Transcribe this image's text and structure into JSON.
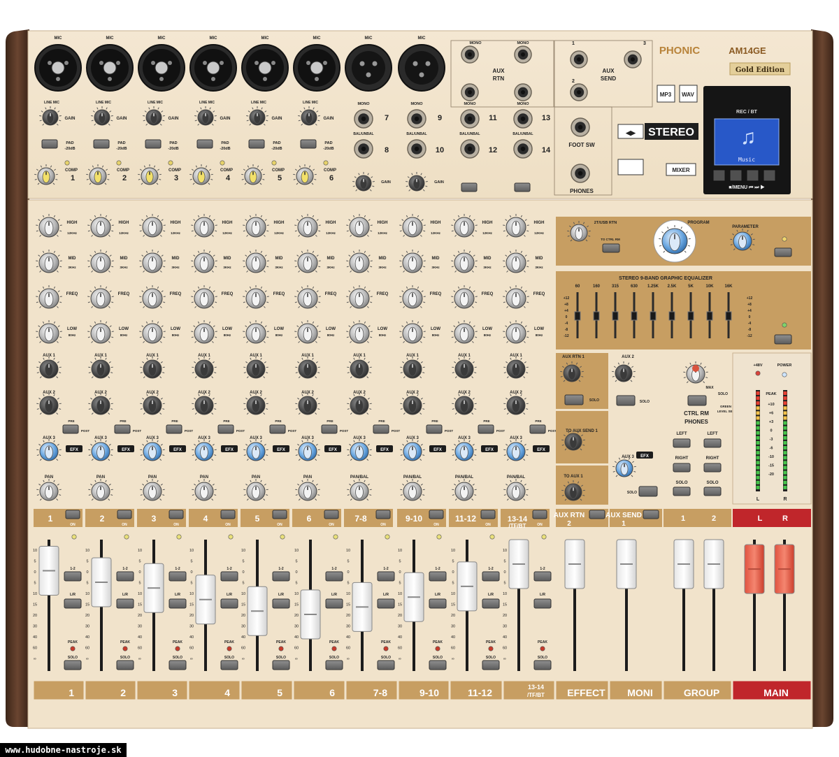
{
  "brand": {
    "name": "PHONIC",
    "model": "AM14GE",
    "edition": "Gold Edition"
  },
  "top_badges": {
    "mp3": "MP3",
    "wav": "WAV",
    "stereo": "STEREO",
    "mixer": "MIXER"
  },
  "display": {
    "header": "REC / BT",
    "screen_text": "Music",
    "controls": "■/MENU  ⏮  ⏭  ▶"
  },
  "inputs": {
    "mic_label": "MIC",
    "line_mic_label": "LINE MIC",
    "gain_label": "GAIN",
    "pad_label": "PAD -20dB",
    "comp_label": "COMP",
    "mic_channels": [
      "1",
      "2",
      "3",
      "4",
      "5",
      "6"
    ],
    "stereo_groups": [
      {
        "mono": "MONO",
        "bal": "BAL/UNBAL",
        "ch_top": "7",
        "ch_bot": "8"
      },
      {
        "mono": "MONO",
        "bal": "BAL/UNBAL",
        "ch_top": "9",
        "ch_bot": "10"
      },
      {
        "mono": "MONO",
        "bal": "BAL/UNBAL",
        "ch_top": "11",
        "ch_bot": "12"
      },
      {
        "mono": "MONO",
        "bal": "BAL/UNBAL",
        "ch_top": "13",
        "ch_bot": "14"
      }
    ]
  },
  "aux_rtn": {
    "label": "AUX RTN",
    "mono": "MONO"
  },
  "aux_send": {
    "label": "AUX SEND",
    "nums": [
      "1",
      "2",
      "3"
    ]
  },
  "foot_sw": "FOOT SW",
  "phones": "PHONES",
  "channel_strip": {
    "eq_labels": [
      "HIGH",
      "MID",
      "FREQ",
      "LOW"
    ],
    "eq_freqs": [
      "12KHz",
      "3KHz",
      "80Hz"
    ],
    "aux_labels": [
      "AUX 1",
      "AUX 2",
      "AUX 3"
    ],
    "efx": "EFX",
    "pan": "PAN",
    "pan_bal": "PAN/BAL",
    "pre": "PRE",
    "post": "POST",
    "on": "ON",
    "peak": "PEAK",
    "solo": "SOLO",
    "assign_12": "1-2",
    "assign_lr": "L/R"
  },
  "channel_labels": [
    "1",
    "2",
    "3",
    "4",
    "5",
    "6",
    "7-8",
    "9-10",
    "11-12",
    "13-14 /TF/BT"
  ],
  "bottom_labels": [
    "1",
    "2",
    "3",
    "4",
    "5",
    "6",
    "7-8",
    "9-10",
    "11-12",
    "13-14 /TF/BT",
    "EFFECT",
    "MONI",
    "GROUP",
    "MAIN"
  ],
  "master_top_labels": [
    "AUX RTN 2",
    "AUX SEND 1",
    "1",
    "2",
    "L",
    "R"
  ],
  "effects": {
    "rtn_label": "2T/USB RTN",
    "to_ctrl_rm": "TO CTRL RM",
    "program": "PROGRAM",
    "parameter": "PARAMETER"
  },
  "geq": {
    "title": "STEREO 9-BAND GRAPHIC EQUALIZER",
    "bands": [
      "60",
      "160",
      "315",
      "630",
      "1.25K",
      "2.5K",
      "5K",
      "10K",
      "16K"
    ],
    "scale": [
      "+12",
      "+8",
      "+4",
      "0",
      "-4",
      "-8",
      "-12"
    ],
    "on": "ON"
  },
  "master_section": {
    "aux_rtn_1": "AUX RTN 1",
    "to_aux_send_1": "TO AUX SEND 1",
    "to_aux_1": "TO AUX 1",
    "aux_2": "AUX 2",
    "aux_3": "AUX 3",
    "ctrl_rm_phones": "CTRL RM PHONES",
    "green_level_set": "GREEN LEVEL SET",
    "left": "LEFT",
    "right": "RIGHT",
    "p48v": "+48V",
    "power": "POWER",
    "solo": "SOLO",
    "max": "MAX"
  },
  "meter": {
    "label": "PEAK",
    "scale": [
      "+10",
      "+6",
      "+3",
      "0",
      "-3",
      "-6",
      "-10",
      "-15",
      "-20"
    ],
    "left": "L",
    "right": "R"
  },
  "fader_scale": [
    "10",
    "5",
    "0",
    "5",
    "10",
    "15",
    "20",
    "30",
    "40",
    "60",
    "∞"
  ],
  "fader_levels": [
    0.92,
    0.78,
    0.71,
    0.57,
    0.43,
    0.39,
    0.48,
    0.6,
    0.73,
    1.0,
    1.0,
    1.0,
    1.0,
    1.0,
    0.94,
    0.94
  ],
  "watermark": "www.hudobne-nastroje.sk",
  "colors": {
    "panel": "#f2e4cd",
    "panel_dark": "#e6d3b4",
    "gold": "#c3995b",
    "wood": "#5a3a28",
    "main_red": "#c0262b",
    "text": "#222222"
  }
}
